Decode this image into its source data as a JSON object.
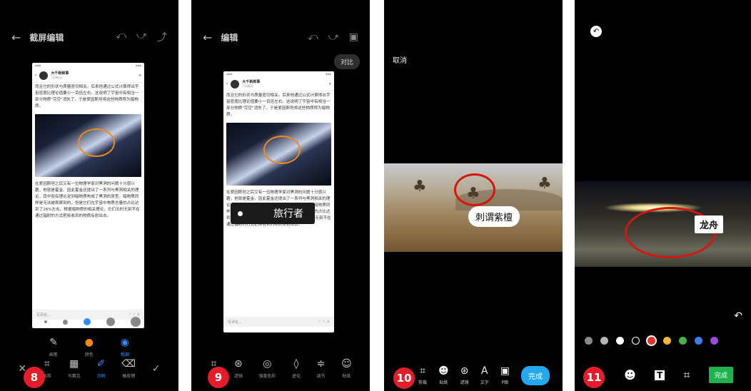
{
  "panels": [
    {
      "badge": "8",
      "title": "截屏编辑",
      "article": {
        "author": "大千新鲜事",
        "sub": "734粉丝",
        "para1": "而且它的形状与质量密切相关。后来他通过公式计算得出宇宙密度比理论值要小一百倍左右。这说明了宇宙中有相当一部分物质\"完空\"消失了。于是爱因斯坦将这些物质称为暗物质。",
        "para2": "在爱因斯坦之后又有一位物理学家对黑洞的问题十分感兴趣，他就是霍金。因此霍金还提出了一系列与黑洞相关的理论，其中就有理论说到暗物质构成了黑洞的原型。暗物质同样是无法被观察到的，但是它们在宇宙中物质总量的占比达到了26%左右。根据暗物质的相关理论，它们无时无刻不在通过辐射的方式把吸收到的物质反射出去。"
      },
      "comment_placeholder": "写评论...",
      "pen_tools": [
        {
          "label": "画笔"
        },
        {
          "label": "颜色"
        },
        {
          "label": "粗细"
        }
      ],
      "bottom_tools": [
        {
          "label": "裁剪"
        },
        {
          "label": "马赛克"
        },
        {
          "label": "涂鸦"
        },
        {
          "label": "橡皮擦"
        }
      ]
    },
    {
      "badge": "9",
      "title": "编辑",
      "compare": "对比",
      "sticker_text": "旅行者",
      "comment_placeholder": "写评论...",
      "bottom_tools": [
        {
          "label": "裁剪"
        },
        {
          "label": "滤镜"
        },
        {
          "label": "强度色彩"
        },
        {
          "label": "虚化"
        },
        {
          "label": "调节"
        },
        {
          "label": "贴纸"
        }
      ]
    },
    {
      "badge": "10",
      "cancel": "取消",
      "label": "刺谓紫檀",
      "tools": [
        {
          "label": "剪裁"
        },
        {
          "label": "贴纸"
        },
        {
          "label": "滤镜"
        },
        {
          "label": "文字"
        },
        {
          "label": "P图"
        }
      ],
      "done": "完成"
    },
    {
      "badge": "11",
      "label": "龙舟",
      "done": "完成",
      "colors": [
        "#8a8a8a",
        "#b5b5b5",
        "#ffffff",
        "#000000",
        "#e0322b",
        "#f3b63b",
        "#46b548",
        "#3b7cf2",
        "#9a4ae0"
      ]
    }
  ]
}
